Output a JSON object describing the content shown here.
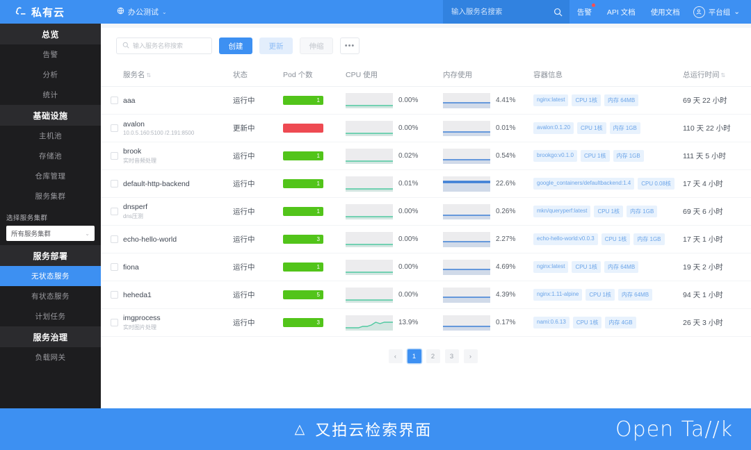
{
  "header": {
    "logo_text": "私有云",
    "logo_icon": "cloud-icon",
    "project_name": "办公测试",
    "project_icon": "globe-icon",
    "project_caret": "⌄",
    "search_placeholder": "输入服务名搜索",
    "search_value": "",
    "search_icon": "search-icon",
    "links": [
      {
        "label": "告警",
        "has_badge": true
      },
      {
        "label": "API 文档",
        "has_badge": false
      },
      {
        "label": "使用文档",
        "has_badge": false
      }
    ],
    "user_name": "平台组",
    "user_caret": "⌄",
    "accent_color": "#3d90f2",
    "badge_color": "#ff4d4f"
  },
  "sidebar": {
    "groups": [
      {
        "title": "总览",
        "items": [
          {
            "label": "告警",
            "active": false
          },
          {
            "label": "分析",
            "active": false
          },
          {
            "label": "统计",
            "active": false
          }
        ]
      },
      {
        "title": "基础设施",
        "items": [
          {
            "label": "主机池",
            "active": false
          },
          {
            "label": "存储池",
            "active": false
          },
          {
            "label": "仓库管理",
            "active": false
          },
          {
            "label": "服务集群",
            "active": false
          }
        ]
      }
    ],
    "cluster_picker": {
      "label": "选择服务集群",
      "selected": "所有服务集群",
      "caret": "⌄",
      "options": [
        "所有服务集群"
      ]
    },
    "groups2": [
      {
        "title": "服务部署",
        "items": [
          {
            "label": "无状态服务",
            "active": true
          },
          {
            "label": "有状态服务",
            "active": false
          },
          {
            "label": "计划任务",
            "active": false
          }
        ]
      },
      {
        "title": "服务治理",
        "items": [
          {
            "label": "负载网关",
            "active": false
          }
        ]
      }
    ]
  },
  "toolbar": {
    "search_placeholder": "输入服务名称搜索",
    "search_value": "",
    "search_icon": "search-icon",
    "create_label": "创建",
    "update_label": "更新",
    "scale_label": "伸缩",
    "more_label": "•••"
  },
  "table": {
    "columns": [
      {
        "label": "",
        "sortable": false
      },
      {
        "label": "服务名",
        "sortable": true
      },
      {
        "label": "状态",
        "sortable": false
      },
      {
        "label": "Pod 个数",
        "sortable": false
      },
      {
        "label": "CPU 使用",
        "sortable": false
      },
      {
        "label": "内存使用",
        "sortable": false
      },
      {
        "label": "容器信息",
        "sortable": false
      },
      {
        "label": "总运行时间",
        "sortable": true
      }
    ],
    "sort_icon": "⇅",
    "rows": [
      {
        "name": "aaa",
        "sub": "",
        "state": "运行中",
        "state_type": "running",
        "pods": "1",
        "pod_type": "ok",
        "cpu_pct": "0.00%",
        "cpu_series": [
          1,
          1,
          1,
          1,
          1,
          1,
          1,
          1,
          1,
          1,
          1,
          1
        ],
        "mem_pct": "4.41%",
        "mem_series": [
          3,
          3,
          3,
          3,
          3,
          3,
          3,
          3,
          3,
          3,
          3,
          3
        ],
        "tags": [
          "nginx:latest",
          "CPU 1核",
          "内存 64MB"
        ],
        "uptime": "69 天 22 小时"
      },
      {
        "name": "avalon",
        "sub": "10.0.5.160:5100 /2.191:8500",
        "state": "更新中",
        "state_type": "updating",
        "pods": "",
        "pod_type": "warn",
        "cpu_pct": "0.00%",
        "cpu_series": [
          1,
          1,
          1,
          1,
          1,
          1,
          1,
          1,
          1,
          1,
          1,
          1
        ],
        "mem_pct": "0.01%",
        "mem_series": [
          2,
          2,
          2,
          2,
          2,
          2,
          2,
          2,
          2,
          2,
          2,
          2
        ],
        "tags": [
          "avalon:0.1.20",
          "CPU 1核",
          "内存 1GB"
        ],
        "uptime": "110 天 22 小时"
      },
      {
        "name": "brook",
        "sub": "实时音频处理",
        "state": "运行中",
        "state_type": "running",
        "pods": "1",
        "pod_type": "ok",
        "cpu_pct": "0.02%",
        "cpu_series": [
          1,
          1,
          1,
          1,
          1,
          1,
          1,
          1,
          1,
          1,
          1,
          1
        ],
        "mem_pct": "0.54%",
        "mem_series": [
          2,
          2,
          2,
          2,
          2,
          2,
          2,
          2,
          2,
          2,
          2,
          2
        ],
        "tags": [
          "brookgo:v0.1.0",
          "CPU 1核",
          "内存 1GB"
        ],
        "uptime": "111 天 5 小时"
      },
      {
        "name": "default-http-backend",
        "sub": "",
        "state": "运行中",
        "state_type": "running",
        "pods": "1",
        "pod_type": "ok",
        "cpu_pct": "0.01%",
        "cpu_series": [
          1,
          1,
          1,
          1,
          1,
          1,
          1,
          1,
          1,
          1,
          1,
          1
        ],
        "mem_pct": "22.6%",
        "mem_series": [
          6,
          6,
          6,
          6,
          6,
          6,
          6,
          6,
          6,
          6,
          6,
          6
        ],
        "tags": [
          "google_containers/defaultbackend:1.4",
          "CPU 0.08核"
        ],
        "uptime": "17 天 4 小时"
      },
      {
        "name": "dnsperf",
        "sub": "dns压测",
        "state": "运行中",
        "state_type": "running",
        "pods": "1",
        "pod_type": "ok",
        "cpu_pct": "0.00%",
        "cpu_series": [
          1,
          1,
          1,
          1,
          1,
          1,
          1,
          1,
          1,
          1,
          1,
          1
        ],
        "mem_pct": "0.26%",
        "mem_series": [
          2,
          2,
          2,
          2,
          2,
          2,
          2,
          2,
          2,
          2,
          2,
          2
        ],
        "tags": [
          "mkn/queryperf:latest",
          "CPU 1核",
          "内存 1GB"
        ],
        "uptime": "69 天 6 小时"
      },
      {
        "name": "echo-hello-world",
        "sub": "",
        "state": "运行中",
        "state_type": "running",
        "pods": "3",
        "pod_type": "ok",
        "cpu_pct": "0.00%",
        "cpu_series": [
          1,
          1,
          1,
          1,
          1,
          1,
          1,
          1,
          1,
          1,
          1,
          1
        ],
        "mem_pct": "2.27%",
        "mem_series": [
          3,
          3,
          3,
          3,
          3,
          3,
          3,
          3,
          3,
          3,
          3,
          3
        ],
        "tags": [
          "echo-hello-world:v0.0.3",
          "CPU 1核",
          "内存 1GB"
        ],
        "uptime": "17 天 1 小时"
      },
      {
        "name": "fiona",
        "sub": "",
        "state": "运行中",
        "state_type": "running",
        "pods": "1",
        "pod_type": "ok",
        "cpu_pct": "0.00%",
        "cpu_series": [
          1,
          1,
          1,
          1,
          1,
          1,
          1,
          1,
          1,
          1,
          1,
          1
        ],
        "mem_pct": "4.69%",
        "mem_series": [
          3,
          3,
          3,
          3,
          3,
          3,
          3,
          3,
          3,
          3,
          3,
          3
        ],
        "tags": [
          "nginx:latest",
          "CPU 1核",
          "内存 64MB"
        ],
        "uptime": "19 天 2 小时"
      },
      {
        "name": "heheda1",
        "sub": "",
        "state": "运行中",
        "state_type": "running",
        "pods": "5",
        "pod_type": "ok",
        "cpu_pct": "0.00%",
        "cpu_series": [
          1,
          1,
          1,
          1,
          1,
          1,
          1,
          1,
          1,
          1,
          1,
          1
        ],
        "mem_pct": "4.39%",
        "mem_series": [
          3,
          3,
          3,
          3,
          3,
          3,
          3,
          3,
          3,
          3,
          3,
          3
        ],
        "tags": [
          "nginx:1.11-alpine",
          "CPU 1核",
          "内存 64MB"
        ],
        "uptime": "94 天 1 小时"
      },
      {
        "name": "imgprocess",
        "sub": "实时图片处理",
        "state": "运行中",
        "state_type": "running",
        "pods": "3",
        "pod_type": "ok",
        "cpu_pct": "13.9%",
        "cpu_series": [
          1,
          1,
          1,
          1,
          2,
          2,
          3,
          5,
          4,
          5,
          5,
          5
        ],
        "mem_pct": "0.17%",
        "mem_series": [
          2,
          2,
          2,
          2,
          2,
          2,
          2,
          2,
          2,
          2,
          2,
          2
        ],
        "tags": [
          "nami:0.6.13",
          "CPU 1核",
          "内存 4GB"
        ],
        "uptime": "26 天 3 小时"
      }
    ]
  },
  "pagination": {
    "prev": "‹",
    "next": "›",
    "pages": [
      "1",
      "2",
      "3"
    ],
    "current": "1"
  },
  "banner": {
    "triangle_icon": "triangle-icon",
    "caption": "又拍云检索界面",
    "logo": "Open Ta//k"
  },
  "colors": {
    "accent": "#3d90f2",
    "pod_ok": "#52c41a",
    "pod_warn": "#ee4a52",
    "cpu_line": "#4ec9a0",
    "mem_line": "#3d7fd6",
    "tag_bg": "#e8f2fd",
    "tag_text": "#6ba4e8"
  }
}
